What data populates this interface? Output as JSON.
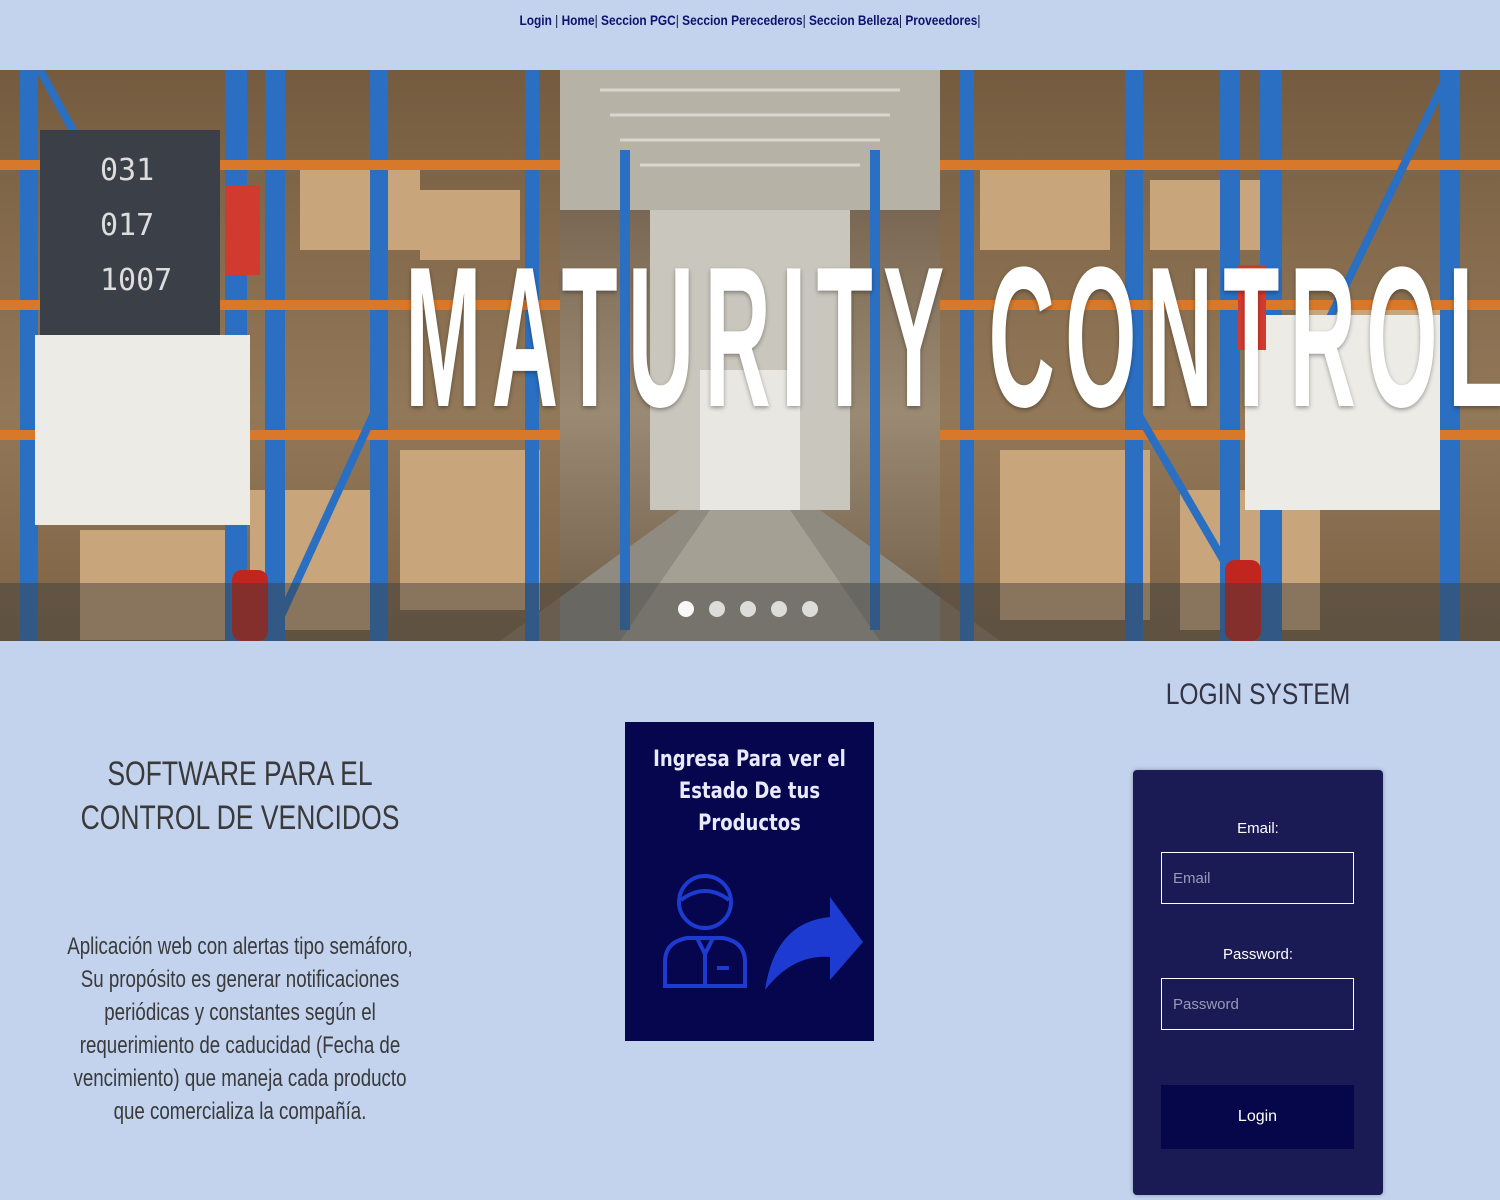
{
  "nav": {
    "items": [
      {
        "label": "Login"
      },
      {
        "label": "Home"
      },
      {
        "label": "Seccion PGC"
      },
      {
        "label": "Seccion Perecederos"
      },
      {
        "label": "Seccion Belleza"
      },
      {
        "label": "Proveedores"
      }
    ],
    "separator": "|"
  },
  "hero": {
    "title": "MATURITY CONTROL",
    "image": "warehouse-aisle-photo",
    "carousel_slides": 5,
    "active_slide": 1
  },
  "intro": {
    "title": "SOFTWARE PARA EL CONTROL DE VENCIDOS",
    "description": "Aplicación web con alertas tipo semáforo, Su propósito es generar notificaciones periódicas y constantes según el requerimiento de caducidad (Fecha de vencimiento) que maneja cada producto que comercializa la compañía."
  },
  "promo": {
    "text": "Ingresa Para ver el Estado De tus Productos",
    "icons": [
      "user-icon",
      "arrow-icon"
    ]
  },
  "login": {
    "heading": "LOGIN SYSTEM",
    "email_label": "Email:",
    "email_placeholder": "Email",
    "password_label": "Password:",
    "password_placeholder": "Password",
    "button_label": "Login"
  },
  "colors": {
    "page_bg": "#c3d3ee",
    "login_box": "#1a1a55",
    "promo_bg": "#06064f",
    "button_bg": "#06064a"
  }
}
